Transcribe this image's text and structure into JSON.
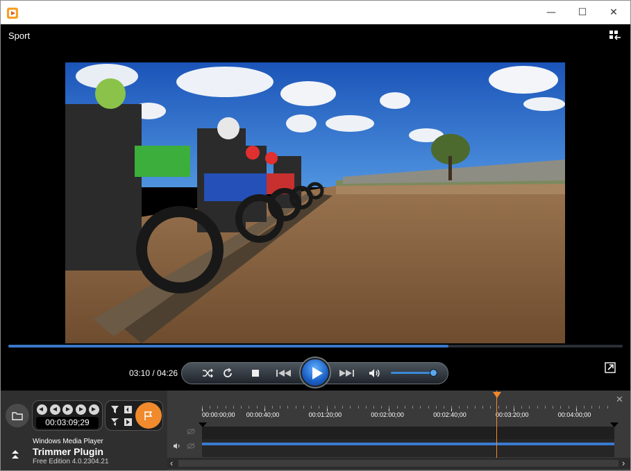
{
  "window": {
    "app_icon": "media-player-icon",
    "controls": {
      "minimize": "—",
      "maximize": "☐",
      "close": "✕"
    }
  },
  "player": {
    "media_title": "Sport",
    "time": "03:10 / 04:26",
    "progress": 0.716,
    "volume": 0.85
  },
  "trimmer": {
    "position": "00:03:09;29",
    "host_name": "Windows Media Player",
    "plugin_name": "Trimmer Plugin",
    "edition": "Free Edition 4.0.2304.21",
    "ruler_ticks": [
      "00:00:00;00",
      "00:00:40;00",
      "00:01:20;00",
      "00:02:00;00",
      "00:02:40;00",
      "00:03:20;00",
      "00:04:00;00"
    ],
    "accent_color": "#f08a2c",
    "scroll_left": "‹",
    "scroll_right": "›",
    "close_label": "✕"
  }
}
